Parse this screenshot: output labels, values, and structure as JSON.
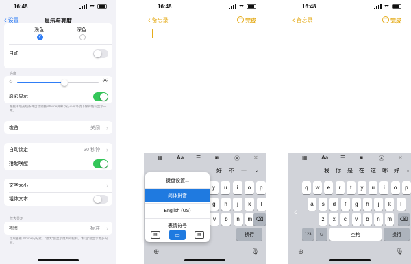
{
  "status": {
    "time": "16:48"
  },
  "left": {
    "back_label": "设置",
    "title": "显示与亮度",
    "light_label": "浅色",
    "dark_label": "深色",
    "auto_label": "自动",
    "brightness_header": "亮度",
    "brightness_level": 0.55,
    "truetone_label": "原彩显示",
    "truetone_desc": "根据环境光线条件自动调整 iPhone屏幕以在不同环境下保持色彩显示一致。",
    "nightshift_label": "夜览",
    "nightshift_value": "关闭",
    "autolock_label": "自动锁定",
    "autolock_value": "30 秒钟",
    "raise_label": "抬起唤醒",
    "textsize_label": "文字大小",
    "bold_label": "粗体文本",
    "zoom_header": "放大显示",
    "view_label": "视图",
    "view_value": "标准",
    "view_desc": "选取查看 iPhone的方式。\"放大\"会显示更大的控制。\"标准\"会显示更多内容。"
  },
  "mid": {
    "back_label": "备忘录",
    "done_label": "完成",
    "toolbar": {
      "format": "Aa"
    },
    "candidates": [
      "好",
      "不",
      "一"
    ],
    "popup": {
      "items": [
        "键盘设置...",
        "简体拼音",
        "English (US)",
        "表情符号"
      ],
      "selected": "简体拼音"
    },
    "return_label": "换行"
  },
  "right": {
    "back_label": "备忘录",
    "done_label": "完成",
    "toolbar": {
      "format": "Aa"
    },
    "candidates": [
      "我",
      "你",
      "是",
      "在",
      "这",
      "哪",
      "好"
    ],
    "row1": [
      "q",
      "w",
      "e",
      "r",
      "t",
      "y",
      "u",
      "i",
      "o",
      "p"
    ],
    "row2": [
      "a",
      "s",
      "d",
      "f",
      "g",
      "h",
      "j",
      "k",
      "l"
    ],
    "row3": [
      "z",
      "x",
      "c",
      "v",
      "b",
      "n",
      "m"
    ],
    "num_label": "123",
    "space_label": "空格",
    "return_label": "换行",
    "mid_row1_visible": [
      "y",
      "u",
      "i",
      "o",
      "p"
    ],
    "mid_row2_visible": [
      "f",
      "g",
      "h",
      "j",
      "k",
      "l"
    ],
    "mid_row3_visible": [
      "v",
      "b",
      "n",
      "m"
    ]
  },
  "icons": [
    "back-chevron-icon",
    "wifi-icon",
    "battery-icon",
    "sun-icon",
    "table-icon",
    "checklist-icon",
    "camera-icon",
    "pen-icon",
    "close-icon",
    "globe-icon",
    "mic-icon",
    "emoji-icon",
    "delete-icon"
  ]
}
